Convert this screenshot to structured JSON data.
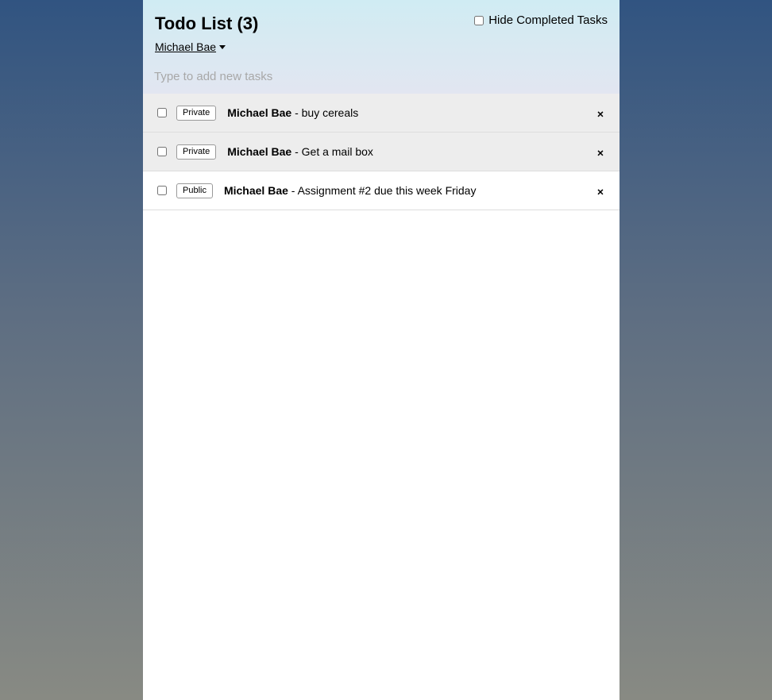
{
  "header": {
    "title": "Todo List (3)",
    "hide_completed_label": "Hide Completed Tasks",
    "hide_completed_checked": false,
    "user_menu_label": "Michael Bae",
    "new_task_placeholder": "Type to add new tasks"
  },
  "tasks": [
    {
      "privacy": "Private",
      "owner": "Michael Bae",
      "separator": " - ",
      "text": "buy cereals",
      "checked": false,
      "delete_label": "×"
    },
    {
      "privacy": "Private",
      "owner": "Michael Bae",
      "separator": " - ",
      "text": "Get a mail box",
      "checked": false,
      "delete_label": "×"
    },
    {
      "privacy": "Public",
      "owner": "Michael Bae",
      "separator": " - ",
      "text": "Assignment #2 due this week Friday",
      "checked": false,
      "delete_label": "×"
    }
  ],
  "colors": {
    "private_row_bg": "#ededed",
    "public_row_bg": "#ffffff",
    "header_gradient_top": "#d0ecf3",
    "header_gradient_bottom": "#e2e6f1",
    "page_gradient_top": "#315481",
    "page_gradient_bottom": "#888a83"
  },
  "icons": {
    "user_menu": "caret-down-icon",
    "delete": "close-icon"
  }
}
